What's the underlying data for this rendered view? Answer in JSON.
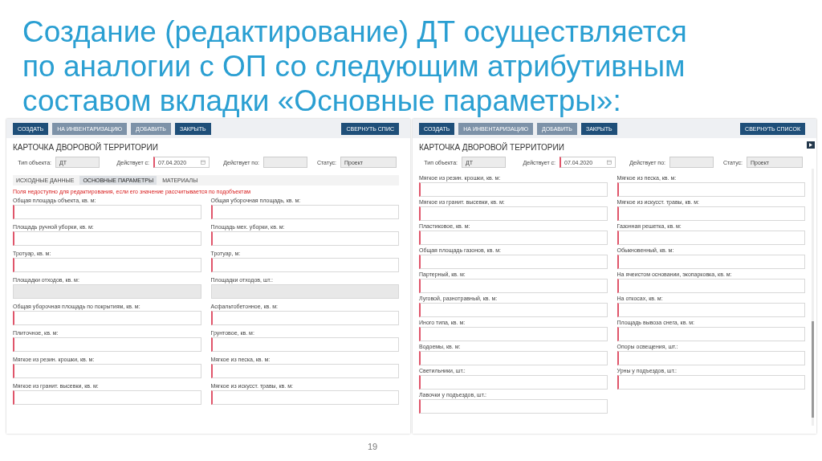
{
  "slide": {
    "title_lines": [
      "Создание (редактирование) ДТ осуществляется",
      "по аналогии с ОП со следующим атрибутивным",
      "составом вкладки «Основные параметры»:"
    ],
    "page_number": "19"
  },
  "screens": [
    {
      "toolbar": [
        {
          "label": "СОЗДАТЬ",
          "disabled": false
        },
        {
          "label": "НА ИНВЕНТАРИЗАЦИЮ",
          "disabled": true
        },
        {
          "label": "ДОБАВИТЬ",
          "disabled": true
        },
        {
          "label": "ЗАКРЫТЬ",
          "disabled": false
        }
      ],
      "collapse_button": "СВЕРНУТЬ СПИС",
      "card_title": "КАРТОЧКА ДВОРОВОЙ ТЕРРИТОРИИ",
      "header": {
        "type_label": "Тип объекта:",
        "type_value": "ДТ",
        "from_label": "Действует с:",
        "from_value": "07.04.2020",
        "to_label": "Действует по:",
        "status_label": "Статус:",
        "status_value": "Проект"
      },
      "tabs": [
        {
          "label": "ИСХОДНЫЕ ДАННЫЕ",
          "selected": false
        },
        {
          "label": "ОСНОВНЫЕ ПАРАМЕТРЫ",
          "selected": true
        },
        {
          "label": "МАТЕРИАЛЫ",
          "selected": false
        }
      ],
      "notice": "Поля недоступно для редактирования, если его значение рассчитывается по подобъектам",
      "columns": [
        [
          {
            "label": "Общая площадь объекта, кв. м:",
            "disabled": false
          },
          {
            "label": "Площадь ручной уборки, кв. м:",
            "disabled": false
          },
          {
            "label": "Тротуар, кв. м:",
            "disabled": false
          },
          {
            "label": "Площадки отходов, кв. м:",
            "disabled": true
          },
          {
            "label": "Общая уборочная площадь по покрытиям, кв. м:",
            "disabled": false
          },
          {
            "label": "Плиточное, кв. м:",
            "disabled": false
          },
          {
            "label": "Мягкое из резин. крошки, кв. м:",
            "disabled": false
          },
          {
            "label": "Мягкое из гранит. высевки, кв. м:",
            "disabled": false
          }
        ],
        [
          {
            "label": "Общая уборочная площадь, кв. м:",
            "disabled": false
          },
          {
            "label": "Площадь мех. уборки, кв. м:",
            "disabled": false
          },
          {
            "label": "Тротуар, м:",
            "disabled": false
          },
          {
            "label": "Площадки отходов, шт.:",
            "disabled": true
          },
          {
            "label": "Асфальтобетонное, кв. м:",
            "disabled": false
          },
          {
            "label": "Грунтовое, кв. м:",
            "disabled": false
          },
          {
            "label": "Мягкое из песка, кв. м:",
            "disabled": false
          },
          {
            "label": "Мягкое из искусст. травы, кв. м:",
            "disabled": false
          }
        ]
      ]
    },
    {
      "toolbar": [
        {
          "label": "СОЗДАТЬ",
          "disabled": false
        },
        {
          "label": "НА ИНВЕНТАРИЗАЦИЮ",
          "disabled": true
        },
        {
          "label": "ДОБАВИТЬ",
          "disabled": true
        },
        {
          "label": "ЗАКРЫТЬ",
          "disabled": false
        }
      ],
      "collapse_button": "СВЕРНУТЬ СПИСОК",
      "side_toggle": true,
      "scrollbar": true,
      "card_title": "КАРТОЧКА ДВОРОВОЙ ТЕРРИТОРИИ",
      "header": {
        "type_label": "Тип объекта:",
        "type_value": "ДТ",
        "from_label": "Действует с:",
        "from_value": "07.04.2020",
        "to_label": "Действует по:",
        "status_label": "Статус:",
        "status_value": "Проект"
      },
      "columns": [
        [
          {
            "label": "Мягкое из резин. крошки, кв. м:",
            "disabled": false
          },
          {
            "label": "Мягкое из гранит. высевки, кв. м:",
            "disabled": false
          },
          {
            "label": "Пластиковое, кв. м:",
            "disabled": false
          },
          {
            "label": "Общая площадь газонов, кв. м:",
            "disabled": false
          },
          {
            "label": "Партерный, кв. м:",
            "disabled": false
          },
          {
            "label": "Луговой, разнотравный, кв. м:",
            "disabled": false
          },
          {
            "label": "Иного типа, кв. м:",
            "disabled": false
          },
          {
            "label": "Водоемы, кв. м:",
            "disabled": false
          },
          {
            "label": "Светильники, шт.:",
            "disabled": false
          },
          {
            "label": "Лавочки у подъездов, шт.:",
            "disabled": false
          }
        ],
        [
          {
            "label": "Мягкое из песка, кв. м:",
            "disabled": false
          },
          {
            "label": "Мягкое из искусст. травы, кв. м:",
            "disabled": false
          },
          {
            "label": "Газонная решетка, кв. м:",
            "disabled": false
          },
          {
            "label": "Обыкновенный, кв. м:",
            "disabled": false
          },
          {
            "label": "На ячеистом основании, экопарковка, кв. м:",
            "disabled": false
          },
          {
            "label": "На откосах, кв. м:",
            "disabled": false
          },
          {
            "label": "Площадь вывоза снега, кв. м:",
            "disabled": false
          },
          {
            "label": "Опоры освещения, шт.:",
            "disabled": false
          },
          {
            "label": "Урны у подъездов, шт.:",
            "disabled": false
          }
        ]
      ]
    }
  ]
}
